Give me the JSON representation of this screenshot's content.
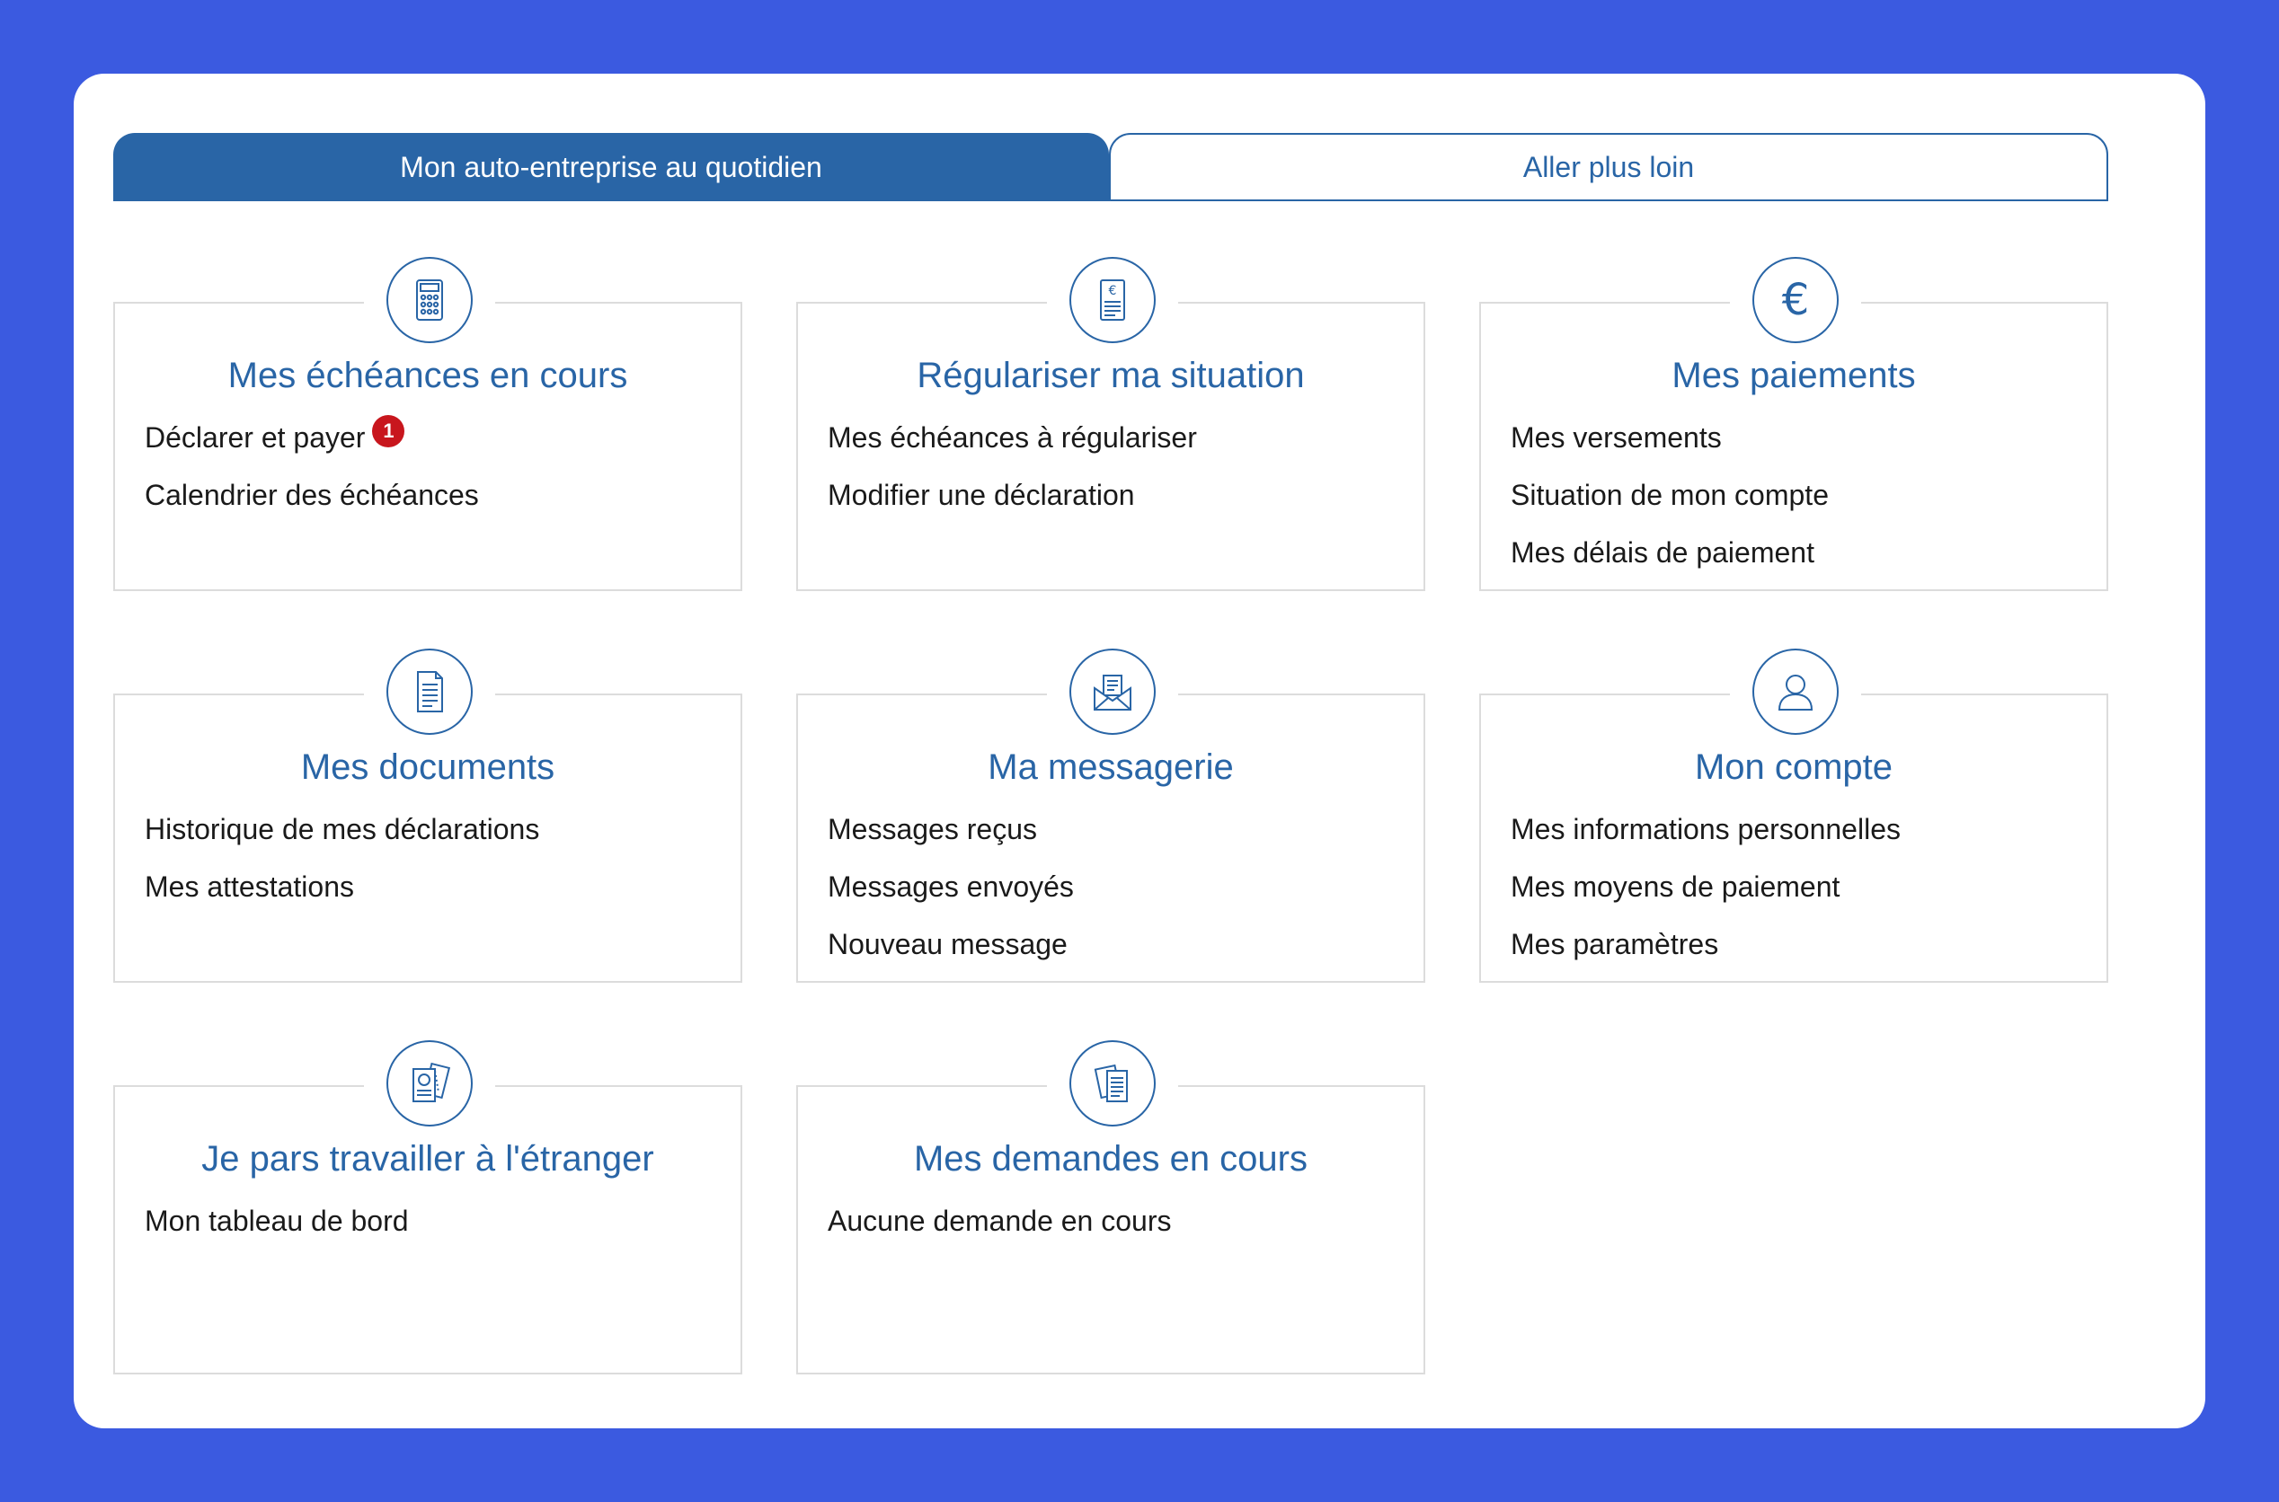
{
  "tabs": [
    {
      "label": "Mon auto-entreprise au quotidien",
      "active": true
    },
    {
      "label": "Aller plus loin",
      "active": false
    }
  ],
  "colors": {
    "accent": "#2965a6",
    "background": "#3b5ae0",
    "badge": "#c8161d",
    "card_border": "#dcdcdc"
  },
  "cards": [
    {
      "icon": "calculator-icon",
      "title": "Mes échéances en cours",
      "links": [
        {
          "label": "Déclarer et payer",
          "badge": "1"
        },
        {
          "label": "Calendrier des échéances"
        }
      ]
    },
    {
      "icon": "euro-document-icon",
      "title": "Régulariser ma situation",
      "links": [
        {
          "label": "Mes échéances à régulariser"
        },
        {
          "label": "Modifier une déclaration"
        }
      ]
    },
    {
      "icon": "euro-icon",
      "title": "Mes paiements",
      "links": [
        {
          "label": "Mes versements"
        },
        {
          "label": "Situation de mon compte"
        },
        {
          "label": "Mes délais de paiement"
        }
      ]
    },
    {
      "icon": "document-icon",
      "title": "Mes documents",
      "links": [
        {
          "label": "Historique de mes déclarations"
        },
        {
          "label": "Mes attestations"
        }
      ]
    },
    {
      "icon": "envelope-icon",
      "title": "Ma messagerie",
      "links": [
        {
          "label": "Messages reçus"
        },
        {
          "label": "Messages envoyés"
        },
        {
          "label": "Nouveau message"
        }
      ]
    },
    {
      "icon": "user-icon",
      "title": "Mon compte",
      "links": [
        {
          "label": "Mes informations personnelles"
        },
        {
          "label": "Mes moyens de paiement"
        },
        {
          "label": "Mes paramètres"
        }
      ]
    },
    {
      "icon": "travel-documents-icon",
      "title": "Je pars travailler à l'étranger",
      "links": [
        {
          "label": "Mon tableau de bord"
        }
      ]
    },
    {
      "icon": "requests-documents-icon",
      "title": "Mes demandes en cours",
      "links": [
        {
          "label": "Aucune demande en cours"
        }
      ]
    }
  ]
}
